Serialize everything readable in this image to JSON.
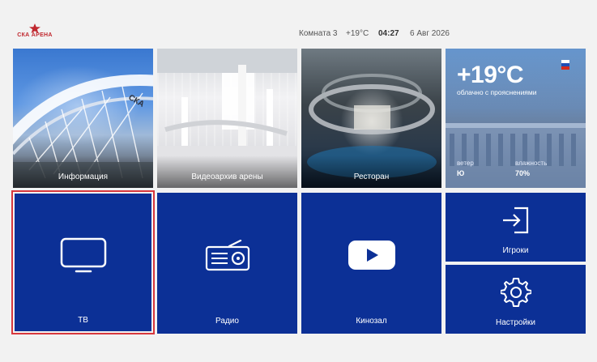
{
  "header": {
    "logo_text": "СКА АРЕНА",
    "room": "Комната 3",
    "temperature": "+19°C",
    "time": "04:27",
    "date": "6 Авг 2026"
  },
  "tiles": {
    "info": {
      "label": "Информация"
    },
    "video_archive": {
      "label": "Видеоархив арены"
    },
    "restaurant": {
      "label": "Ресторан"
    },
    "weather": {
      "temperature": "+19°C",
      "description": "облачно с прояснениями",
      "wind_label": "ветер",
      "wind_value": "Ю",
      "humidity_label": "влажность",
      "humidity_value": "70%"
    },
    "tv": {
      "label": "ТВ",
      "icon": "tv-icon",
      "selected": true
    },
    "radio": {
      "label": "Радио",
      "icon": "radio-icon"
    },
    "cinema": {
      "label": "Кинозал",
      "icon": "youtube-play-icon"
    },
    "players": {
      "label": "Игроки",
      "icon": "login-arrow-icon"
    },
    "settings": {
      "label": "Настройки",
      "icon": "gear-icon"
    }
  },
  "colors": {
    "background": "#f2f2f2",
    "tile_blue": "#0c3096",
    "focus_border": "#d7373d",
    "logo_red": "#c0282f"
  }
}
